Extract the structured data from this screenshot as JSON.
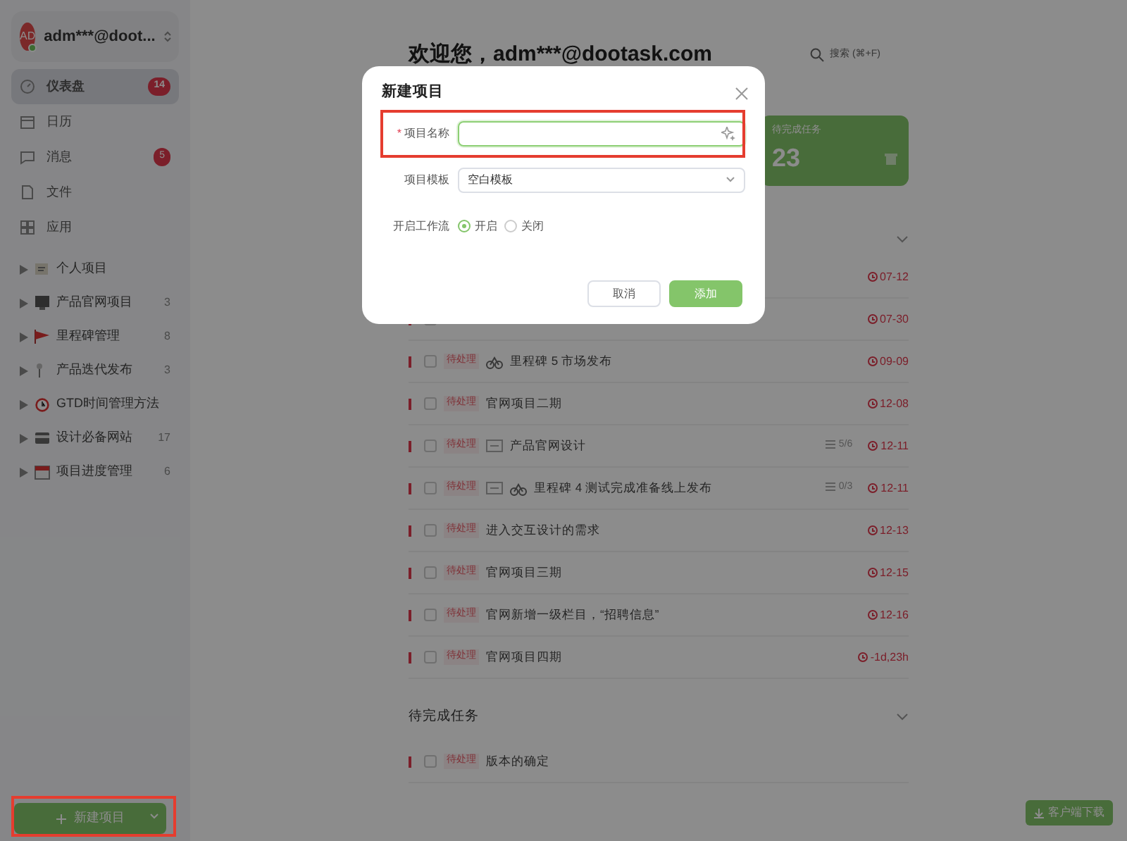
{
  "sidebar": {
    "user": {
      "avatar": "AD",
      "online": true,
      "name": "adm***@doot..."
    },
    "menu": [
      {
        "label": "仪表盘",
        "badge": "14",
        "selected": true
      },
      {
        "label": "日历",
        "selected": false
      },
      {
        "label": "消息",
        "badge": "5",
        "selected": false
      },
      {
        "label": "文件",
        "selected": false
      },
      {
        "label": "应用",
        "selected": false
      }
    ],
    "projects": [
      {
        "label": "个人项目"
      },
      {
        "label": "产品官网项目",
        "count": "3"
      },
      {
        "label": "里程碑管理",
        "count": "8"
      },
      {
        "label": "产品迭代发布",
        "count": "3"
      },
      {
        "label": "GTD时间管理方法"
      },
      {
        "label": "设计必备网站",
        "count": "17"
      },
      {
        "label": "项目进度管理",
        "count": "6"
      }
    ],
    "new_project_button": {
      "label": "新建项目",
      "highlighted": true
    }
  },
  "main": {
    "greeting": "欢迎您，adm***@dootask.com",
    "search": {
      "label": "搜索 (⌘+F)"
    },
    "stat_card": {
      "label": "待完成任务",
      "value": "23"
    },
    "sections": [
      {
        "tasks": [
          {
            "date": "07-12"
          },
          {
            "date": "07-30"
          },
          {
            "kind": "milestone",
            "checked": false,
            "tag": "待处理",
            "title": "里程碑 5 市场发布",
            "date": "09-09"
          },
          {
            "kind": "task",
            "checked": false,
            "tag": "待处理",
            "title": "官网项目二期",
            "date": "12-08"
          },
          {
            "kind": "task",
            "checked": false,
            "tag": "待处理",
            "subtask": true,
            "title": "产品官网设计",
            "progress": "5/6",
            "date": "12-11"
          },
          {
            "kind": "milestone",
            "checked": false,
            "tag": "待处理",
            "subtask": true,
            "title": "里程碑 4 测试完成准备线上发布",
            "progress": "0/3",
            "date": "12-11"
          },
          {
            "kind": "task",
            "checked": false,
            "tag": "待处理",
            "title": "进入交互设计的需求",
            "date": "12-13"
          },
          {
            "kind": "task",
            "checked": false,
            "tag": "待处理",
            "title": "官网项目三期",
            "date": "12-15"
          },
          {
            "kind": "task",
            "checked": false,
            "tag": "待处理",
            "title": "官网新增一级栏目，“招聘信息”",
            "date": "12-16"
          },
          {
            "kind": "task",
            "checked": false,
            "tag": "待处理",
            "title": "官网项目四期",
            "date": "-1d,23h"
          }
        ]
      },
      {
        "title": "待完成任务",
        "tasks": [
          {
            "kind": "task",
            "checked": false,
            "tag": "待处理",
            "title": "版本的确定"
          }
        ]
      }
    ],
    "download_button": {
      "label": "客户端下载"
    }
  },
  "dialog": {
    "title": "新建项目",
    "fields": [
      {
        "kind": "text",
        "label": "项目名称",
        "required_mark": "*",
        "highlighted": true
      },
      {
        "kind": "select",
        "label": "项目模板",
        "value": "空白模板"
      },
      {
        "kind": "radio",
        "label": "开启工作流",
        "options": [
          {
            "label": "开启",
            "selected": true
          },
          {
            "label": "关闭",
            "selected": false
          }
        ]
      }
    ],
    "buttons": [
      {
        "kind": "secondary",
        "label": "取消"
      },
      {
        "kind": "primary",
        "label": "添加"
      }
    ]
  }
}
